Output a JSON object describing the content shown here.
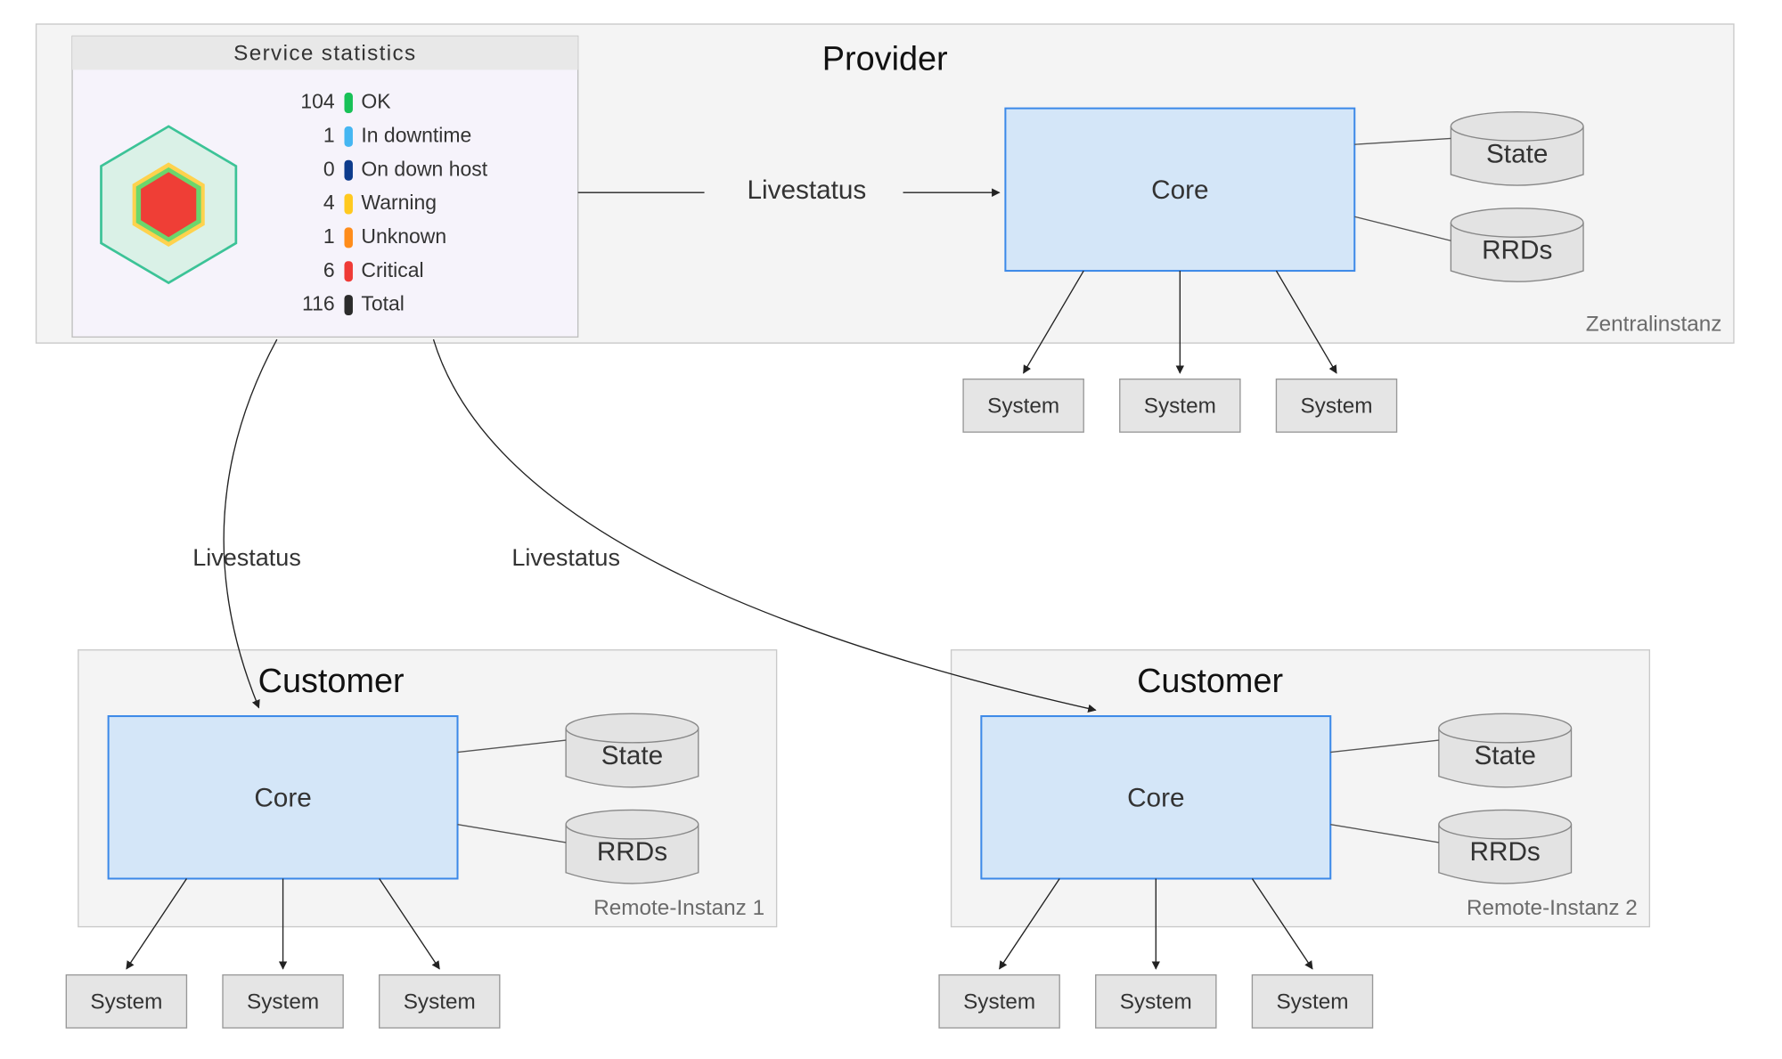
{
  "provider": {
    "title": "Provider",
    "core": "Core",
    "zentral": "Zentralinstanz",
    "state": "State",
    "rrds": "RRDs",
    "sys": "System",
    "livestatus": "Livestatus"
  },
  "cust1": {
    "title": "Customer",
    "core": "Core",
    "remote": "Remote-Instanz 1",
    "state": "State",
    "rrds": "RRDs",
    "sys": "System",
    "livestatus": "Livestatus"
  },
  "cust2": {
    "title": "Customer",
    "core": "Core",
    "remote": "Remote-Instanz 2",
    "state": "State",
    "rrds": "RRDs",
    "sys": "System",
    "livestatus": "Livestatus"
  },
  "stats": {
    "title": "Service statistics",
    "ok_n": "104",
    "ok_l": "OK",
    "dt_n": "1",
    "dt_l": "In downtime",
    "dh_n": "0",
    "dh_l": "On down host",
    "wa_n": "4",
    "wa_l": "Warning",
    "un_n": "1",
    "un_l": "Unknown",
    "cr_n": "6",
    "cr_l": "Critical",
    "to_n": "116",
    "to_l": "Total"
  }
}
